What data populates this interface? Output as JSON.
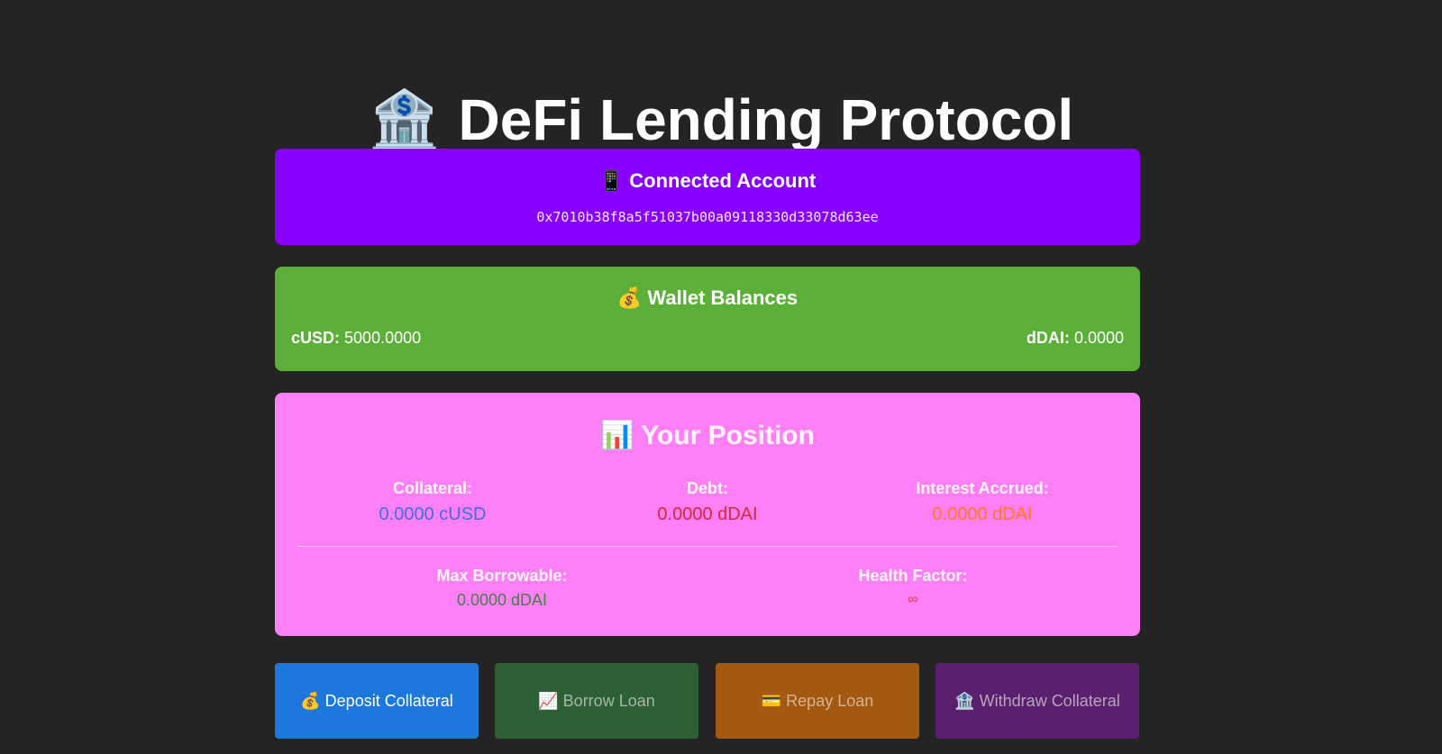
{
  "header": {
    "icon": "🏦",
    "icon_name": "bank-building-icon",
    "title": "DeFi Lending Protocol"
  },
  "account": {
    "icon": "📱",
    "heading": "Connected Account",
    "address": "0x7010b38f8a5f51037b00a09118330d33078d63ee",
    "color": "#8800ff"
  },
  "wallet": {
    "icon": "💰",
    "heading": "Wallet Balances",
    "color": "#5caf39",
    "balances": [
      {
        "label": "cUSD:",
        "value": "5000.0000"
      },
      {
        "label": "dDAI:",
        "value": "0.0000"
      }
    ]
  },
  "position": {
    "icon": "📊",
    "heading": "Your Position",
    "color": "#ff80f6",
    "stats": [
      {
        "label": "Collateral:",
        "value": "0.0000 cUSD",
        "color": "#3b6fe8"
      },
      {
        "label": "Debt:",
        "value": "0.0000 dDAI",
        "color": "#d62839"
      },
      {
        "label": "Interest Accrued:",
        "value": "0.0000 dDAI",
        "color": "#ff7a1a"
      },
      {
        "label": "Max Borrowable:",
        "value": "0.0000 dDAI",
        "color": "#4c7a4c"
      },
      {
        "label": "Health Factor:",
        "value": "∞",
        "color": "#e83a52"
      }
    ]
  },
  "actions": [
    {
      "icon": "💰",
      "label": "Deposit Collateral",
      "color": "#1c78db",
      "enabled": true
    },
    {
      "icon": "📈",
      "label": "Borrow Loan",
      "color": "#2e6035",
      "enabled": false
    },
    {
      "icon": "💳",
      "label": "Repay Loan",
      "color": "#a35911",
      "enabled": false
    },
    {
      "icon": "🏦",
      "label": "Withdraw Collateral",
      "color": "#5a206e",
      "enabled": false
    }
  ]
}
